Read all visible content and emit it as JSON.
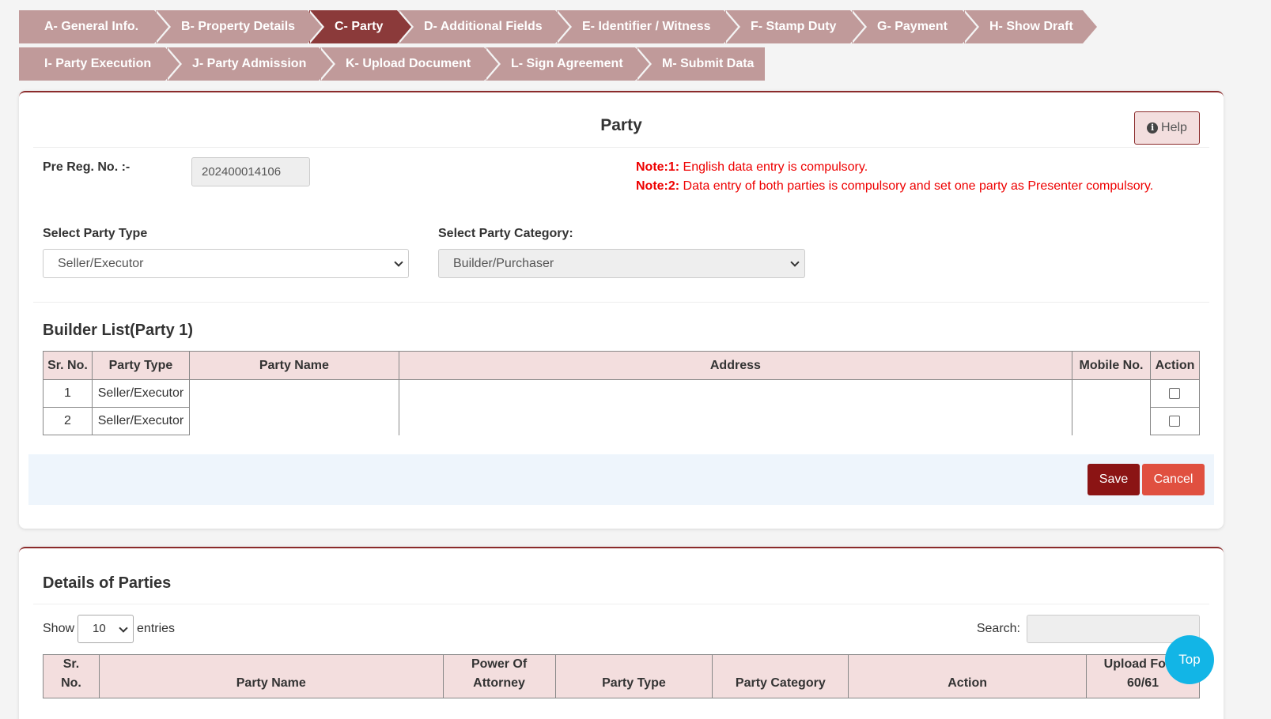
{
  "steps_row1": [
    {
      "label": "A- General Info."
    },
    {
      "label": "B- Property Details"
    },
    {
      "label": "C- Party"
    },
    {
      "label": "D- Additional Fields"
    },
    {
      "label": "E- Identifier / Witness"
    },
    {
      "label": "F- Stamp Duty"
    },
    {
      "label": "G- Payment"
    },
    {
      "label": "H- Show Draft"
    }
  ],
  "steps_row2": [
    {
      "label": "I- Party Execution"
    },
    {
      "label": "J- Party Admission"
    },
    {
      "label": "K- Upload Document"
    },
    {
      "label": "L- Sign Agreement"
    },
    {
      "label": "M- Submit Data"
    }
  ],
  "active_step": "C- Party",
  "party": {
    "title": "Party",
    "help_label": "Help",
    "prereg_label": "Pre Reg. No. :-",
    "prereg_value": "202400014106",
    "note1_prefix": "Note:1:",
    "note1_text": " English data entry is compulsory.",
    "note2_prefix": "Note:2:",
    "note2_text": " Data entry of both parties is compulsory and set one party as Presenter compulsory.",
    "party_type_label": "Select Party Type",
    "party_type_value": "Seller/Executor",
    "party_category_label": "Select Party Category:",
    "party_category_value": "Builder/Purchaser"
  },
  "builder": {
    "heading": "Builder List(Party 1)",
    "columns": [
      "Sr. No.",
      "Party Type",
      "Party Name",
      "Address",
      "Mobile No.",
      "Action"
    ],
    "rows": [
      {
        "sr": "1",
        "type": "Seller/Executor",
        "name": "",
        "address": "",
        "mobile": ""
      },
      {
        "sr": "2",
        "type": "Seller/Executor",
        "name": "",
        "address": "",
        "mobile": ""
      }
    ]
  },
  "actions": {
    "save": "Save",
    "cancel": "Cancel"
  },
  "details": {
    "heading": "Details of Parties",
    "show": "Show",
    "entries_value": "10",
    "entries": "entries",
    "search_label": "Search:",
    "columns": {
      "sr_line1": "Sr.",
      "sr_line2": "No.",
      "name": "Party Name",
      "poa_line1": "Power Of",
      "poa_line2": "Attorney",
      "type": "Party Type",
      "category": "Party Category",
      "action": "Action",
      "upload_line1": "Upload Form",
      "upload_line2": "60/61"
    }
  },
  "top_label": "Top"
}
